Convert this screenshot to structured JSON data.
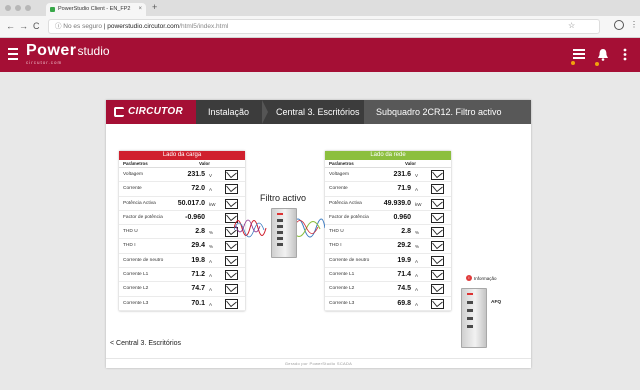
{
  "browser": {
    "tab_title": "PowerStudio Client - EN_FP2",
    "tab_close": "×",
    "new_tab": "+",
    "back": "←",
    "forward": "→",
    "reload": "C",
    "security_text": "ⓘ No es seguro",
    "url_host": "powerstudio.circutor.com",
    "url_path": "/html5/index.html",
    "star": "☆",
    "menu": "⋮"
  },
  "app": {
    "logo_main": "Power",
    "logo_sub": "studio",
    "logo_tag": "circutor.com",
    "accent": "#a50f35"
  },
  "nav": {
    "brand": "CIRCUTOR",
    "crumbs": [
      "Instalação",
      "Central 3. Escritórios",
      "Subquadro 2CR12. Filtro activo"
    ]
  },
  "load_table": {
    "title": "Lado da carga",
    "color": "#d0202e",
    "col_param": "Parâmetros",
    "col_value": "Valor",
    "rows": [
      {
        "label": "Voltagem",
        "value": "231.5",
        "unit": "V"
      },
      {
        "label": "Corrente",
        "value": "72.0",
        "unit": "A"
      },
      {
        "label": "Potência Activa",
        "value": "50.017.0",
        "unit": "kW"
      },
      {
        "label": "Factor de potência",
        "value": "-0.960",
        "unit": ""
      },
      {
        "label": "THD U",
        "value": "2.8",
        "unit": "%"
      },
      {
        "label": "THD I",
        "value": "29.4",
        "unit": "%"
      },
      {
        "label": "Corrente de neutro",
        "value": "19.8",
        "unit": "A"
      },
      {
        "label": "Corrente L1",
        "value": "71.2",
        "unit": "A"
      },
      {
        "label": "Corrente L2",
        "value": "74.7",
        "unit": "A"
      },
      {
        "label": "Corrente L3",
        "value": "70.1",
        "unit": "A"
      }
    ]
  },
  "grid_table": {
    "title": "Lado da rede",
    "color": "#8cbf3f",
    "col_param": "Parâmetros",
    "col_value": "Valor",
    "rows": [
      {
        "label": "Voltagem",
        "value": "231.6",
        "unit": "V"
      },
      {
        "label": "Corrente",
        "value": "71.9",
        "unit": "A"
      },
      {
        "label": "Potência Activa",
        "value": "49.939.0",
        "unit": "kW"
      },
      {
        "label": "Factor de potência",
        "value": "0.960",
        "unit": ""
      },
      {
        "label": "THD U",
        "value": "2.8",
        "unit": "%"
      },
      {
        "label": "THD I",
        "value": "29.2",
        "unit": "%"
      },
      {
        "label": "Corrente de neutro",
        "value": "19.9",
        "unit": "A"
      },
      {
        "label": "Corrente L1",
        "value": "71.4",
        "unit": "A"
      },
      {
        "label": "Corrente L2",
        "value": "74.5",
        "unit": "A"
      },
      {
        "label": "Corrente L3",
        "value": "69.8",
        "unit": "A"
      }
    ]
  },
  "filter_title": "Filtro activo",
  "afq": {
    "badge": "Informação",
    "name": "AFQ"
  },
  "back_link": "Central 3. Escritórios",
  "back_chevron": "<",
  "footer": "Gerado por PowerStudio SCADA",
  "icons": {
    "graph": "trend-graph-icon",
    "menu": "hamburger-icon",
    "list": "list-icon",
    "bell": "bell-icon"
  }
}
